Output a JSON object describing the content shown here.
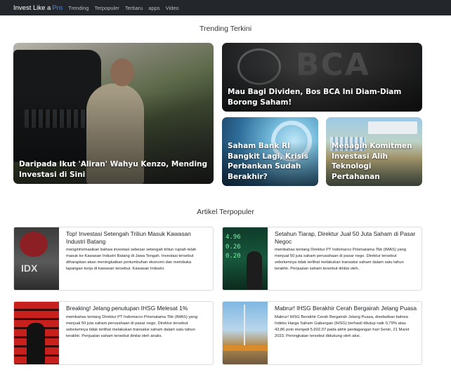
{
  "navbar": {
    "brand": "Invest Like a",
    "brand_accent": "Pro",
    "links": [
      "Trending",
      "Terpopuler",
      "Terbaru",
      "apps",
      "Video"
    ]
  },
  "trending": {
    "title": "Trending Terkini",
    "cards": [
      {
        "caption": "Daripada Ikut 'Aliran' Wahyu Kenzo, Mending Investasi di Sini"
      },
      {
        "caption": "Mau Bagi Dividen, Bos BCA Ini Diam-Diam Borong Saham!"
      },
      {
        "caption": "Saham Bank RI Bangkit Lagi, Krisis Perbankan Sudah Berakhir?"
      },
      {
        "caption": "Menagih Komitmen Investasi Alih Teknologi Pertahanan"
      }
    ]
  },
  "popular": {
    "title": "Artikel Terpopuler",
    "articles": [
      {
        "title": "Top! Investasi Setengah Triliun Masuk Kawasan Industri Batang",
        "desc": "menginformasikan bahwa investasi sebesar setengah triliun rupiah telah masuk ke Kawasan Industri Batang di Jawa Tengah. Investasi tersebut diharapkan akan meningkatkan pertumbuhan ekonomi dan membuka lapangan kerja di kawasan tersebut. Kawasan Industri."
      },
      {
        "title": "Setahun Tiarap, Direktur Jual 50 Juta Saham di Pasar Negoc",
        "desc": "membahas tentang Direktur PT Indomarco Prismatama Tbk (IMAS) yang menjual 50 juta saham perusahaan di pasar nego. Direktur tersebut sebelumnya tidak terlihat melakukan transaksi saham dalam satu tahun terakhir. Penjualan saham tersebut dinilai oleh.."
      },
      {
        "title": "Breaking! Jelang penutupan IHSG Melesat 1%",
        "desc": "membahas tentang Direktur PT Indomarco Prismatama Tbk (IMAS) yang menjual 50 juta saham perusahaan di pasar nego. Direktur tersebut sebelumnya tidak terlihat melakukan transaksi saham dalam satu tahun terakhir. Penjualan saham tersebut dinilai oleh analis."
      },
      {
        "title": "Mabrur! IHSG Berakhir Cerah Bergairah Jelang Puasa",
        "desc": "Mabrur! IHSG Berakhir Cerah Bergairah Jelang Puasa, disebutkan bahwa Indeks Harga Saham Gabungan (IHSG) berhasil ditutup naik 0,79% atau 43,86 poin menjadi 5.602,07 pada akhir perdagangan hari Senin, 21 Maret 2023. Peningkatan tersebut didukung oleh aksi."
      }
    ]
  }
}
